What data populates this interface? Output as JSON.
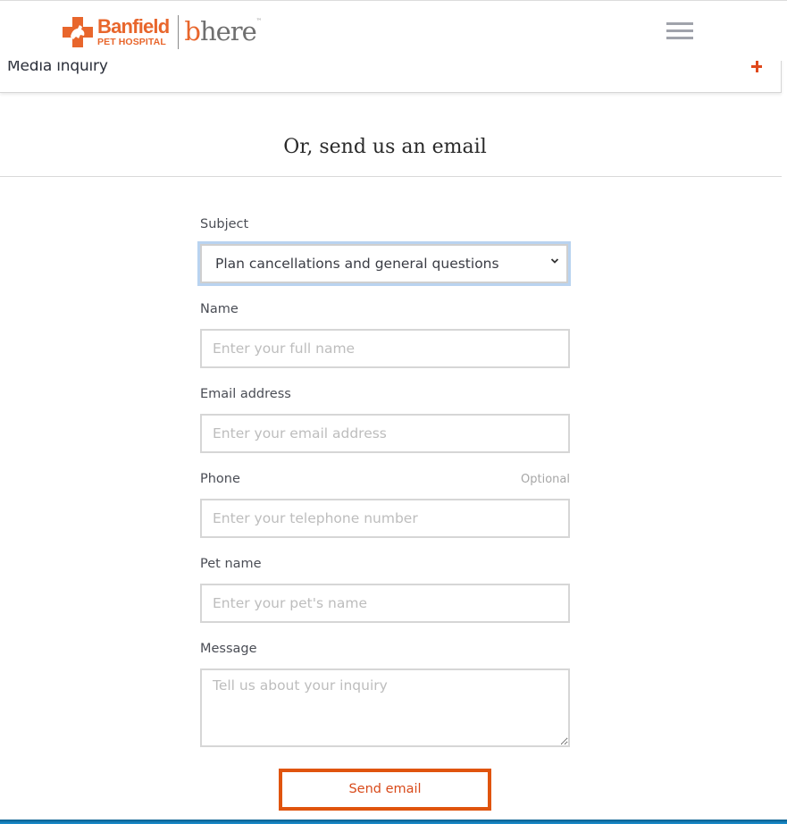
{
  "header": {
    "logo": {
      "brand": "Banfield",
      "sub": "PET HOSPITAL",
      "product_b": "b",
      "product_rest": "here",
      "tm": "™"
    },
    "menu_icon": "hamburger-icon"
  },
  "accordion": {
    "label": "Media inquiry",
    "toggle_icon": "plus-icon"
  },
  "section": {
    "title": "Or, send us an email"
  },
  "form": {
    "subject": {
      "label": "Subject",
      "value": "Plan cancellations and general questions"
    },
    "name": {
      "label": "Name",
      "placeholder": "Enter your full name",
      "value": ""
    },
    "email": {
      "label": "Email address",
      "placeholder": "Enter your email address",
      "value": ""
    },
    "phone": {
      "label": "Phone",
      "optional": "Optional",
      "placeholder": "Enter your telephone number",
      "value": ""
    },
    "pet_name": {
      "label": "Pet name",
      "placeholder": "Enter your pet's name",
      "value": ""
    },
    "message": {
      "label": "Message",
      "placeholder": "Tell us about your inquiry",
      "value": ""
    },
    "submit_label": "Send email"
  },
  "colors": {
    "brand_orange": "#e8662c",
    "button_orange": "#e0540e",
    "focus_blue": "#b9d3f0",
    "footer_blue": "#1a8fd0"
  }
}
